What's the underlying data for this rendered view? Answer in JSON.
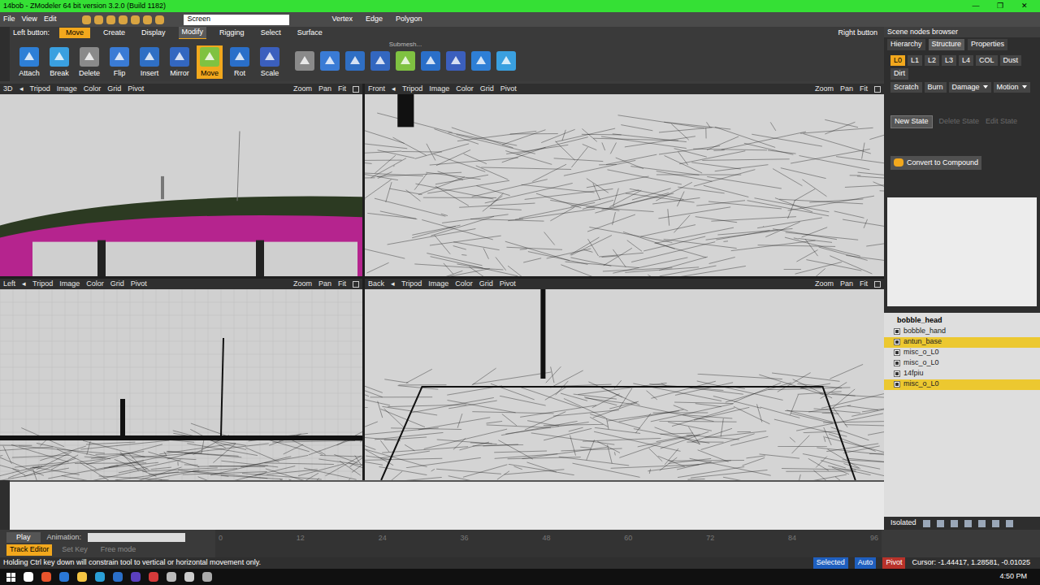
{
  "window": {
    "title": "14bob - ZModeler 64 bit version 3.2.0 (Build 1182)",
    "controls": [
      "—",
      "❐",
      "✕"
    ]
  },
  "menu": [
    "File",
    "View",
    "Edit"
  ],
  "view_mode": "Screen",
  "selection_modes": [
    {
      "label": "Vertex",
      "selected": false
    },
    {
      "label": "Edge",
      "selected": false
    },
    {
      "label": "Polygon",
      "selected": false
    }
  ],
  "left_button": {
    "label": "Left button:",
    "tool": "Move"
  },
  "right_button": "Right button",
  "command_tabs": [
    {
      "label": "Create",
      "selected": false
    },
    {
      "label": "Display",
      "selected": false
    },
    {
      "label": "Modify",
      "selected": true
    },
    {
      "label": "Rigging",
      "selected": false
    },
    {
      "label": "Select",
      "selected": false
    },
    {
      "label": "Surface",
      "selected": false
    }
  ],
  "submesh_label": "Submesh...",
  "tools": [
    {
      "label": "Attach",
      "selected": false
    },
    {
      "label": "Break",
      "selected": false
    },
    {
      "label": "Delete",
      "selected": false
    },
    {
      "label": "Flip",
      "selected": false
    },
    {
      "label": "Insert",
      "selected": false
    },
    {
      "label": "Mirror",
      "selected": false
    },
    {
      "label": "Move",
      "selected": true
    },
    {
      "label": "Rot",
      "selected": false
    },
    {
      "label": "Scale",
      "selected": false
    }
  ],
  "viewports": [
    {
      "name": "3D",
      "toggle": "◂",
      "menu": [
        "Tripod",
        "Image",
        "Color",
        "Grid",
        "Pivot"
      ],
      "nav": [
        "Zoom",
        "Pan",
        "Fit"
      ],
      "kind": "shaded"
    },
    {
      "name": "Front",
      "toggle": "◂",
      "menu": [
        "Tripod",
        "Image",
        "Color",
        "Grid",
        "Pivot"
      ],
      "nav": [
        "Zoom",
        "Pan",
        "Fit"
      ],
      "kind": "side"
    },
    {
      "name": "Left",
      "toggle": "◂",
      "menu": [
        "Tripod",
        "Image",
        "Color",
        "Grid",
        "Pivot"
      ],
      "nav": [
        "Zoom",
        "Pan",
        "Fit"
      ],
      "kind": "grid"
    },
    {
      "name": "Back",
      "toggle": "◂",
      "menu": [
        "Tripod",
        "Image",
        "Color",
        "Grid",
        "Pivot"
      ],
      "nav": [
        "Zoom",
        "Pan",
        "Fit"
      ],
      "kind": "back"
    }
  ],
  "scene_panel": {
    "title": "Scene nodes browser",
    "tabs": [
      {
        "label": "Hierarchy",
        "selected": false
      },
      {
        "label": "Structure",
        "selected": true
      },
      {
        "label": "Properties",
        "selected": false
      }
    ],
    "layers": [
      {
        "label": "L0",
        "selected": true
      },
      {
        "label": "L1",
        "selected": false
      },
      {
        "label": "L2",
        "selected": false
      },
      {
        "label": "L3",
        "selected": false
      },
      {
        "label": "L4",
        "selected": false
      },
      {
        "label": "COL",
        "selected": false
      },
      {
        "label": "Dust",
        "selected": false
      },
      {
        "label": "Dirt",
        "selected": false
      }
    ],
    "layers2": [
      {
        "label": "Scratch",
        "dropdown": false
      },
      {
        "label": "Burn",
        "dropdown": false
      },
      {
        "label": "Damage",
        "dropdown": true
      },
      {
        "label": "Motion",
        "dropdown": true
      }
    ],
    "new_state": "New State",
    "state_buttons": [
      {
        "label": "Delete State",
        "disabled": true
      },
      {
        "label": "Edit State",
        "disabled": true
      }
    ],
    "convert": "Convert to Compound",
    "list_title": "bobble_head",
    "nodes": [
      {
        "name": "bobble_hand",
        "checked": true,
        "selected": false,
        "hovered": false
      },
      {
        "name": "antun_base",
        "checked": true,
        "selected": false,
        "hovered": true
      },
      {
        "name": "misc_o_L0",
        "checked": true,
        "selected": false,
        "hovered": false
      },
      {
        "name": "misc_o_L0",
        "checked": true,
        "selected": false,
        "hovered": false
      },
      {
        "name": "14fpiu",
        "checked": true,
        "selected": false,
        "hovered": false
      },
      {
        "name": "misc_o_L0",
        "checked": true,
        "selected": true,
        "hovered": false
      }
    ],
    "footer": "Isolated"
  },
  "timeline": {
    "play": "Play",
    "animation_label": "Animation:",
    "ticks": [
      "0",
      "12",
      "24",
      "36",
      "48",
      "60",
      "72",
      "84",
      "96"
    ],
    "buttons": [
      {
        "label": "Track Editor",
        "selected": true
      },
      {
        "label": "Set Key",
        "selected": false
      },
      {
        "label": "Free mode",
        "selected": false
      }
    ]
  },
  "status": {
    "message": "Holding Ctrl key down will constrain tool to vertical or horizontal movement only.",
    "badges": [
      {
        "label": "Selected",
        "color": "#1f5fbf"
      },
      {
        "label": "Auto",
        "color": "#1f5fbf"
      },
      {
        "label": "Pivot",
        "color": "#b8322a"
      }
    ],
    "cursor": "Cursor: -1.44417, 1.28581, -0.01025"
  },
  "taskbar": {
    "time": "4:50 PM"
  }
}
